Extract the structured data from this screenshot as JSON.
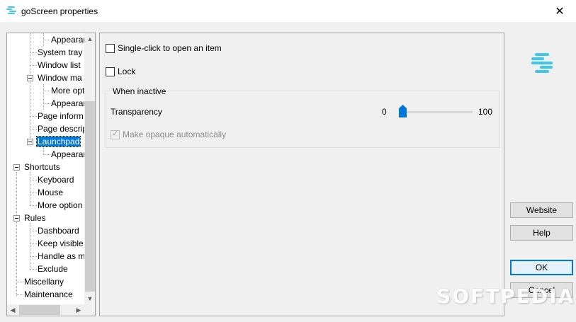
{
  "window": {
    "title": "goScreen properties",
    "close_glyph": "✕",
    "app_icon": "goscreen-logo-icon"
  },
  "tree": {
    "items": [
      {
        "label": "Appearan"
      },
      {
        "label": "System tray"
      },
      {
        "label": "Window list"
      },
      {
        "label": "Window ma"
      },
      {
        "label": "More opt"
      },
      {
        "label": "Appearan"
      },
      {
        "label": "Page inform"
      },
      {
        "label": "Page descrip"
      },
      {
        "label": "Launchpad"
      },
      {
        "label": "Appearan"
      },
      {
        "label": "Shortcuts"
      },
      {
        "label": "Keyboard"
      },
      {
        "label": "Mouse"
      },
      {
        "label": "More option"
      },
      {
        "label": "Rules"
      },
      {
        "label": "Dashboard"
      },
      {
        "label": "Keep visible"
      },
      {
        "label": "Handle as m"
      },
      {
        "label": "Exclude"
      },
      {
        "label": "Miscellany"
      },
      {
        "label": "Maintenance"
      }
    ],
    "selected_item": "Launchpad"
  },
  "options": {
    "single_click_label": "Single-click to open an item",
    "single_click_checked": false,
    "lock_label": "Lock",
    "lock_checked": false
  },
  "inactive_group": {
    "legend": "When inactive",
    "transparency_label": "Transparency",
    "slider_min": "0",
    "slider_max": "100",
    "slider_value": 0,
    "opaque_label": "Make opaque automatically",
    "opaque_checked": true,
    "opaque_disabled": true
  },
  "buttons": {
    "website": "Website",
    "help": "Help",
    "ok": "OK",
    "cancel": "Cancel"
  },
  "watermark": "SOFTPEDIA",
  "colors": {
    "accent": "#0078d7",
    "logo": "#3ec6ee"
  }
}
